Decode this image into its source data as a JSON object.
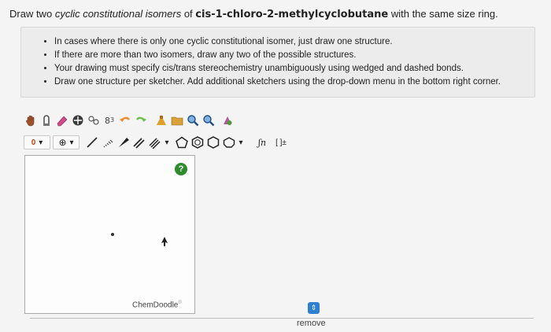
{
  "question": {
    "prefix": "Draw two",
    "italic": "cyclic constitutional isomers",
    "middle": "of",
    "compound": "cis-1-chloro-2-methylcyclobutane",
    "suffix": "with the same size ring."
  },
  "instructions": [
    "In cases where there is only one cyclic constitutional isomer, just draw one structure.",
    "If there are more than two isomers, draw any two of the possible structures.",
    "Your drawing must specify cis/trans stereochemistry unambiguously using wedged and dashed bonds.",
    "Draw one structure per sketcher. Add additional sketchers using the drop-down menu in the bottom right corner."
  ],
  "toolbar": {
    "charge_value": "0",
    "ring_label": "⊕",
    "template_label": "⬡",
    "bracket_label": "[ ]±",
    "function_label": "ʃn"
  },
  "sketcher": {
    "help_label": "?",
    "brand": "ChemDoodle",
    "brand_mark": "®"
  },
  "actions": {
    "dropdown_glyph": "⇕",
    "remove_label": "remove"
  },
  "colors": {
    "help_green": "#2e8b2e",
    "dropdown_blue": "#2f7fd0"
  }
}
